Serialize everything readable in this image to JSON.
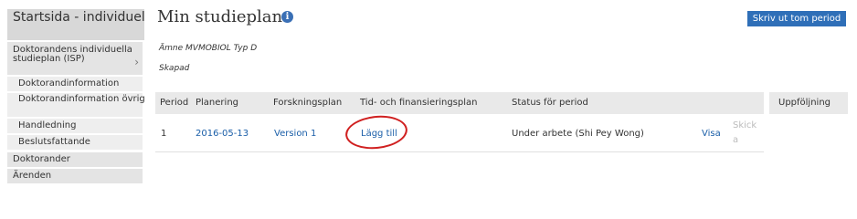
{
  "sidebar": {
    "header": "Startsida - individuell studieplan (ISP)",
    "parent": "Doktorandens individuella studieplan (ISP)",
    "items": [
      {
        "label": "Doktorandinformation"
      },
      {
        "label": "Doktorandinformation övrig"
      },
      {
        "label": "Handledning"
      },
      {
        "label": "Beslutsfattande"
      }
    ],
    "top_items": [
      {
        "label": "Doktorander"
      },
      {
        "label": "Ärenden"
      }
    ]
  },
  "page": {
    "title": "Min studieplan",
    "print_button": "Skriv ut tom period",
    "subject": "Ämne MVMOBIOL Typ D",
    "created": "Skapad"
  },
  "table": {
    "headers": [
      "Period",
      "Planering",
      "Forskningsplan",
      "Tid- och finansieringsplan",
      "Status för period"
    ],
    "side_header": "Uppföljning",
    "row": {
      "period": "1",
      "planering": "2016-05-13",
      "forskningsplan": "Version 1",
      "tid": "Lägg till",
      "status": "Under arbete (Shi Pey Wong)",
      "visa": "Visa",
      "skicka": "Skicka"
    }
  },
  "colors": {
    "accent": "#2f6fb8",
    "highlight": "#d02020"
  }
}
